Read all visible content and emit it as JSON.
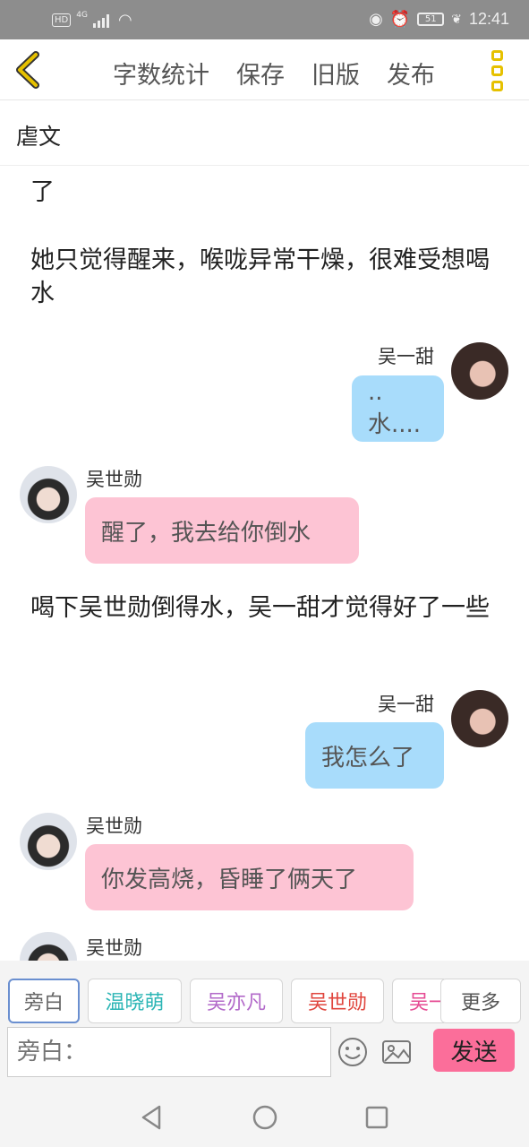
{
  "status_bar": {
    "network": "4G",
    "hd": "HD",
    "battery": "51",
    "time": "12:41"
  },
  "toolbar": {
    "items": [
      "字数统计",
      "保存",
      "旧版",
      "发布"
    ]
  },
  "doc": {
    "title": "虐文"
  },
  "messages": {
    "m0": "了",
    "m1": "她只觉得醒来，喉咙异常干燥，很难受想喝水",
    "m2_name": "吴一甜",
    "m2_text": "..水....",
    "m3_name": "吴世勋",
    "m3_text": "醒了，我去给你倒水",
    "m4": "喝下吴世勋倒得水，吴一甜才觉得好了一些",
    "m5_name": "吴一甜",
    "m5_text": "我怎么了",
    "m6_name": "吴世勋",
    "m6_text": "你发高烧，昏睡了俩天了",
    "m7_name": "吴世勋"
  },
  "characters": [
    {
      "label": "旁白",
      "color": "#666666"
    },
    {
      "label": "温晓萌",
      "color": "#2bb5b5"
    },
    {
      "label": "吴亦凡",
      "color": "#b269c9"
    },
    {
      "label": "吴世勋",
      "color": "#e0453d"
    },
    {
      "label": "吴一",
      "color": "#e64a93"
    }
  ],
  "more_label": "更多",
  "input": {
    "placeholder": "旁白："
  },
  "send_label": "发送",
  "colors": {
    "accent": "#e6c100",
    "send": "#fb6e9a",
    "bubble_self": "#a8dcfb",
    "bubble_other": "#fdc4d4"
  }
}
